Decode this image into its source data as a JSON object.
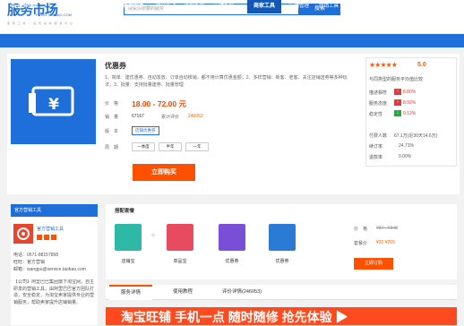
{
  "header": {
    "logo": "服务市场",
    "logo_sub": "FUWU.TAOBAO.COM",
    "logo_tagline": "卖 家 工 具 一 站 式 采 购 服 务 平 台",
    "search_placeholder": "搜索你想要的服务",
    "search_button": "搜索"
  },
  "nav": {
    "category": "服务分类",
    "items": [
      {
        "label": "商家服务",
        "bold": true
      },
      {
        "label": "内容互动"
      },
      {
        "label": "客服外包"
      },
      {
        "label": "店铺外包"
      },
      {
        "label": "商家工具",
        "bold": true,
        "active": true
      },
      {
        "label": "店铺管理"
      },
      {
        "label": "营销工具"
      },
      {
        "label": "数据分析"
      }
    ]
  },
  "product": {
    "title": "优惠券",
    "description": "1、简单：建优惠券、自动发放、订单自动核销，都不用计算优惠金额；2、多样营销：新客、老客、关注店铺送券等多种玩法；3、批量：支持批量建券、批量管理",
    "price_label": "价　格",
    "price": "18.00 - 72.00 元",
    "sales_label": "销　量",
    "sales_value": "67167",
    "comment_label": "累计评价",
    "comment_value": "246053",
    "version_label": "版　本",
    "version_tag": "店铺优惠券",
    "cycle_label": "周　期",
    "cycles": [
      "一季度",
      "半年",
      "一年"
    ],
    "buy_button": "立即购买"
  },
  "rating": {
    "stars": "★★★★★",
    "score": "5.0",
    "title": "与同类型的服务平均值比较",
    "rows": [
      {
        "label": "描述相符",
        "value": "8.80%",
        "trend": "up"
      },
      {
        "label": "服务态度",
        "value": "8.92%",
        "trend": "up"
      },
      {
        "label": "稳定性",
        "value": "9.12%",
        "trend": "down"
      }
    ],
    "paid_label": "付费人数",
    "paid_value": "67.1万(近30天14.6万)",
    "repurchase_label": "续订率",
    "repurchase_value": "24.71%",
    "refund_label": "退款率",
    "refund_value": "0.00%"
  },
  "shop": {
    "header": "官方营销工具",
    "name": "官方营销工具",
    "qq_label": "电话",
    "qq": "0571-88157858",
    "ww_label": "旺旺",
    "ww": "官方营销",
    "email_label": "邮箱",
    "email": "wangpu@service.taobao.com",
    "intro": "【公司】阿里巴巴集团旗下淘宝网，自主研发的营销工具，由阿里巴巴官方团队打造，安全稳定，为淘宝卖家提供专业的营销服务，帮助卖家提升店铺销量。"
  },
  "combo": {
    "title": "搭配套餐",
    "items": [
      {
        "label": "店铺宝",
        "color": "#2eb8a6"
      },
      {
        "label": "单品宝",
        "color": "#e84a5f"
      },
      {
        "label": "优惠券",
        "color": "#7a4fd8"
      },
      {
        "label": "优惠券",
        "color": "#2a7bd6"
      }
    ],
    "price_label": "价　格",
    "price_value": "¥87 - ¥348",
    "combo_price_label": "套餐价",
    "combo_price": "¥30 ¥265",
    "order_button": "立即订购"
  },
  "tabs": [
    {
      "label": "服务详情",
      "active": true
    },
    {
      "label": "使用教程"
    },
    {
      "label": "评价详情(246053)"
    }
  ],
  "banner": {
    "text": "淘宝旺铺 手机一点 随时随修 抢先体验 ▶"
  },
  "colors": {
    "brand": "#1e6fd9",
    "accent": "#ff5000",
    "star": "#ff5a00"
  }
}
